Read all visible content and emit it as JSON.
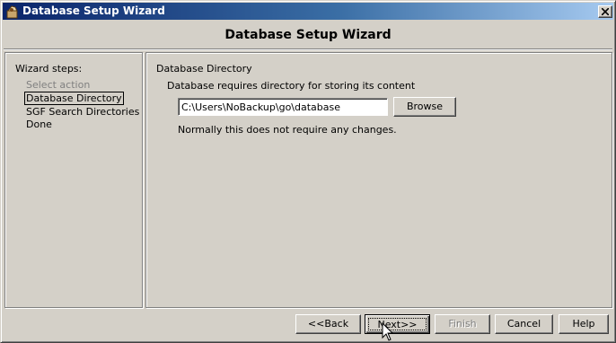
{
  "window": {
    "title": "Database Setup Wizard",
    "icon": "wizard-app-icon",
    "close_icon": "close-icon"
  },
  "header": {
    "title": "Database Setup Wizard"
  },
  "sidebar": {
    "label": "Wizard steps:",
    "steps": [
      {
        "label": "Select action",
        "state": "disabled"
      },
      {
        "label": "Database Directory",
        "state": "current"
      },
      {
        "label": "SGF Search Directories",
        "state": "pending"
      },
      {
        "label": "Done",
        "state": "pending"
      }
    ]
  },
  "main": {
    "section_title": "Database Directory",
    "description": "Database requires directory for storing its content",
    "directory_value": "C:\\Users\\NoBackup\\go\\database",
    "browse_label": "Browse",
    "note": "Normally this does not require any changes."
  },
  "buttons": {
    "back": "<<Back",
    "next": "Next>>",
    "finish": "Finish",
    "cancel": "Cancel",
    "help": "Help"
  },
  "colors": {
    "title_gradient_start": "#0a246a",
    "title_gradient_end": "#a6caf0",
    "face": "#d4d0c8",
    "disabled_text": "#808080"
  }
}
